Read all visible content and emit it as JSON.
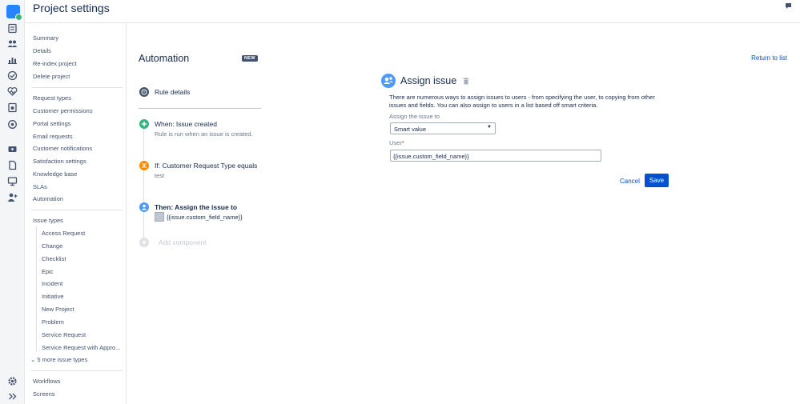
{
  "header": {
    "title": "Project settings"
  },
  "sidebar": {
    "group1": [
      "Summary",
      "Details",
      "Re-index project",
      "Delete project"
    ],
    "group2": [
      "Request types",
      "Customer permissions",
      "Portal settings",
      "Email requests",
      "Customer notifications",
      "Satisfaction settings",
      "Knowledge base",
      "SLAs",
      "Automation"
    ],
    "issue_types_label": "Issue types",
    "issue_types": [
      "Access Request",
      "Change",
      "Checklist",
      "Epic",
      "Incident",
      "Initiative",
      "New Project",
      "Problem",
      "Service Request",
      "Service Request with Appro..."
    ],
    "more_issue_types": "5 more issue types",
    "group4": [
      "Workflows",
      "Screens"
    ]
  },
  "automation": {
    "title": "Automation",
    "badge": "NEW",
    "rule_details": "Rule details",
    "when_title": "When: Issue created",
    "when_sub": "Rule is run when an issue is created.",
    "if_title": "If: Customer Request Type equals",
    "if_sub": "test",
    "then_title": "Then: Assign the issue to",
    "then_sub": "{{issue.custom_field_name}}",
    "add_component": "Add component"
  },
  "panel": {
    "return_link": "Return to list",
    "title": "Assign issue",
    "description": "There are numerous ways to assign issues to users - from specifying the user, to copying from other issues and fields. You can also assign to users in a list based off smart criteria.",
    "assign_label": "Assign the issue to",
    "assign_value": "Smart value",
    "user_label": "User",
    "user_required": "*",
    "user_value": "{{issue.custom_field_name}}",
    "cancel_label": "Cancel",
    "save_label": "Save"
  },
  "colors": {
    "accent": "#0052cc",
    "when": "#36b37e",
    "if": "#ff8b00",
    "then": "#4c9aff",
    "rule": "#42526e"
  }
}
